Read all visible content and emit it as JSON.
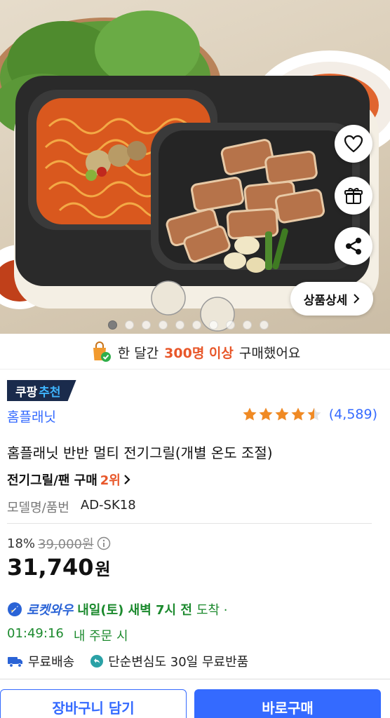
{
  "hero": {
    "image_desc_icon": "electric-grill-product-photo",
    "detail_button_label": "상품상세",
    "carousel": {
      "total": 10,
      "active_index": 0
    }
  },
  "purchase_banner": {
    "prefix": "한 달간",
    "highlight": "300명 이상",
    "suffix": "구매했어요"
  },
  "badge": {
    "part1": "쿠팡",
    "part2": "추천"
  },
  "product": {
    "brand": "홈플래닛",
    "rating": 4.5,
    "review_count": "(4,589)",
    "title": "홈플래닛 반반 멀티 전기그릴(개별 온도 조절)",
    "rank_category": "전기그릴/팬 구매",
    "rank_value": "2위",
    "model_label": "모델명/품번",
    "model_value": "AD-SK18"
  },
  "pricing": {
    "discount_rate": "18%",
    "original_price": "39,000원",
    "sale_price": "31,740",
    "currency": "원"
  },
  "delivery": {
    "service": "로켓와우",
    "arrival": "내일(토) 새벽 7시 전",
    "arrival_suffix": "도착 ·",
    "countdown": "01:49:16",
    "countdown_suffix": "내 주문 시",
    "free_shipping": "무료배송",
    "return_policy": "단순변심도 30일 무료반품"
  },
  "actions": {
    "cart_label": "장바구니 담기",
    "buy_label": "바로구매"
  },
  "colors": {
    "accent_blue": "#346aff",
    "highlight_orange": "#e8572a",
    "rocket_green": "#1c8a2e",
    "star": "#f08a24",
    "badge_bg": "#1a2b4c"
  }
}
